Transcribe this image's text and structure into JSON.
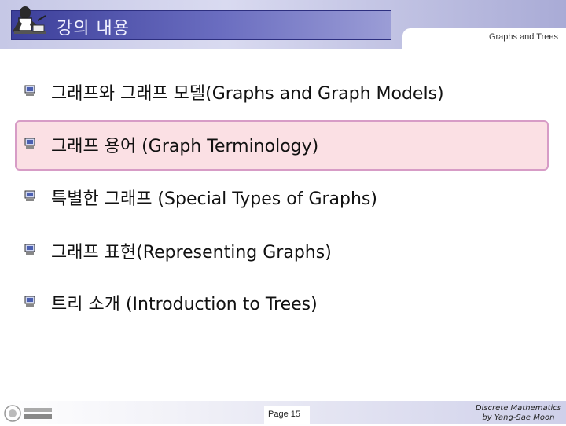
{
  "header": {
    "title": "강의 내용",
    "subtitle": "Graphs and Trees"
  },
  "content": {
    "items": [
      {
        "label": "그래프와 그래프 모델(Graphs and Graph Models)"
      },
      {
        "label": "그래프 용어 (Graph Terminology)"
      },
      {
        "label": "특별한 그래프 (Special Types of Graphs)"
      },
      {
        "label": "그래프 표현(Representing Graphs)"
      },
      {
        "label": "트리 소개 (Introduction to Trees)"
      }
    ],
    "highlighted_index": 1
  },
  "footer": {
    "page": "Page 15",
    "credit_line1": "Discrete Mathematics",
    "credit_line2": "by Yang-Sae Moon"
  },
  "colors": {
    "title_bar": "#4b4fa8",
    "highlight_fill": "#fbe0e4",
    "highlight_border": "#d79cc6"
  },
  "icons": {
    "bullet": "computer-bullet-icon",
    "header_logo": "professor-at-desk-icon",
    "footer_logo": "university-logo-icon"
  }
}
